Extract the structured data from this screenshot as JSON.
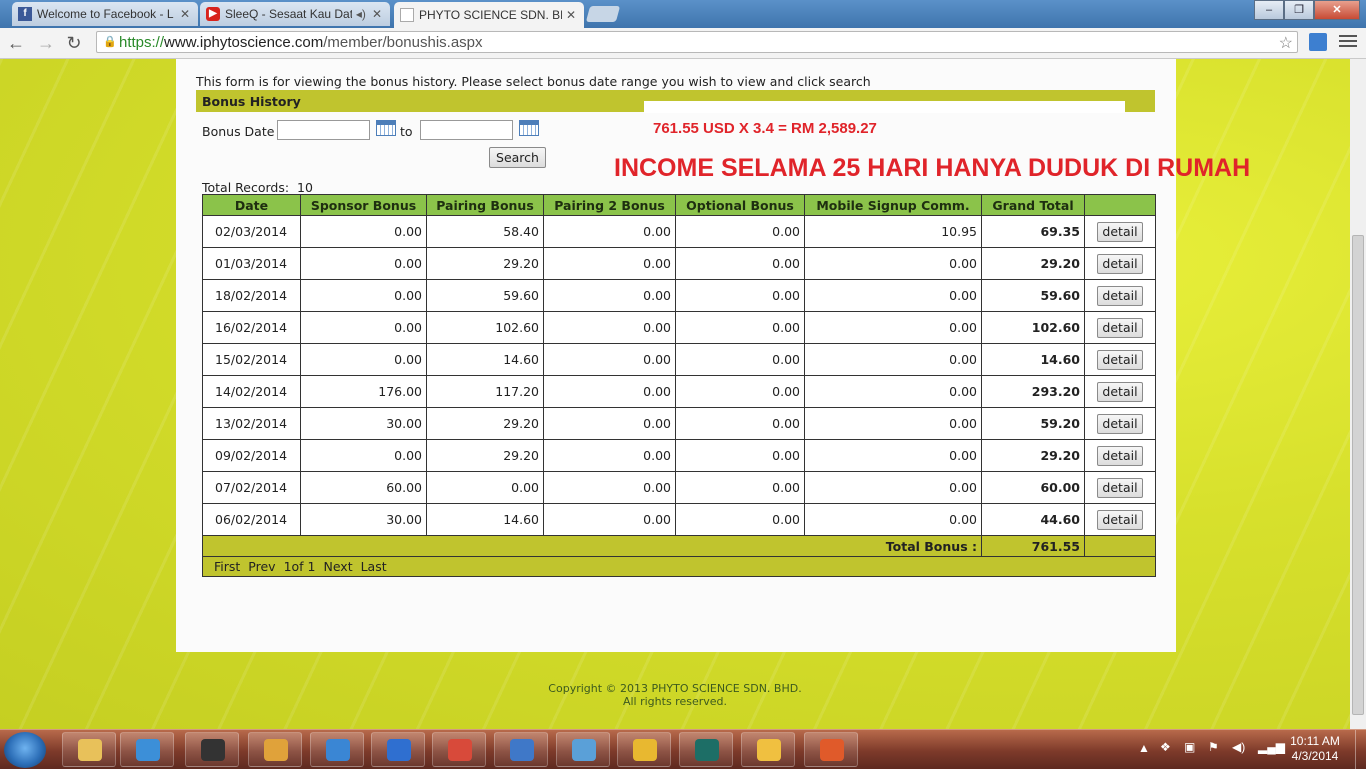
{
  "browser": {
    "tabs": [
      {
        "title": "Welcome to Facebook - L",
        "favicon": "facebook-icon"
      },
      {
        "title": "SleeQ - Sesaat Kau Dat:",
        "favicon": "youtube-icon"
      },
      {
        "title": "PHYTO SCIENCE SDN. BH",
        "favicon": "page-icon",
        "active": true
      }
    ],
    "url_scheme": "https://",
    "url_host": "www.iphytoscience.com",
    "url_path": "/member/bonushis.aspx"
  },
  "page": {
    "intro": "This form is for viewing the bonus history. Please select bonus date range you wish to view and click search",
    "section_title": "Bonus History",
    "bonus_date_label": "Bonus Date",
    "to_label": "to",
    "date_from": "",
    "date_to": "",
    "search_label": "Search",
    "total_records_label": "Total Records:",
    "total_records_value": "10",
    "calc_text": "761.55 USD X 3.4 = RM 2,589.27",
    "income_text": "INCOME SELAMA 25 HARI HANYA DUDUK DI RUMAH"
  },
  "table": {
    "columns": [
      "Date",
      "Sponsor Bonus",
      "Pairing Bonus",
      "Pairing 2 Bonus",
      "Optional Bonus",
      "Mobile Signup Comm.",
      "Grand Total",
      ""
    ],
    "rows": [
      [
        "02/03/2014",
        "0.00",
        "58.40",
        "0.00",
        "0.00",
        "10.95",
        "69.35"
      ],
      [
        "01/03/2014",
        "0.00",
        "29.20",
        "0.00",
        "0.00",
        "0.00",
        "29.20"
      ],
      [
        "18/02/2014",
        "0.00",
        "59.60",
        "0.00",
        "0.00",
        "0.00",
        "59.60"
      ],
      [
        "16/02/2014",
        "0.00",
        "102.60",
        "0.00",
        "0.00",
        "0.00",
        "102.60"
      ],
      [
        "15/02/2014",
        "0.00",
        "14.60",
        "0.00",
        "0.00",
        "0.00",
        "14.60"
      ],
      [
        "14/02/2014",
        "176.00",
        "117.20",
        "0.00",
        "0.00",
        "0.00",
        "293.20"
      ],
      [
        "13/02/2014",
        "30.00",
        "29.20",
        "0.00",
        "0.00",
        "0.00",
        "59.20"
      ],
      [
        "09/02/2014",
        "0.00",
        "29.20",
        "0.00",
        "0.00",
        "0.00",
        "29.20"
      ],
      [
        "07/02/2014",
        "60.00",
        "0.00",
        "0.00",
        "0.00",
        "0.00",
        "60.00"
      ],
      [
        "06/02/2014",
        "30.00",
        "14.60",
        "0.00",
        "0.00",
        "0.00",
        "44.60"
      ]
    ],
    "detail_label": "detail",
    "total_bonus_label": "Total Bonus :",
    "total_bonus_value": "761.55",
    "pager": {
      "first": "First",
      "prev": "Prev",
      "page_info": "1of 1",
      "next": "Next",
      "last": "Last"
    }
  },
  "footer": {
    "copyright": "Copyright © 2013 PHYTO SCIENCE SDN. BHD.",
    "rights": "All rights reserved."
  },
  "taskbar": {
    "apps": [
      "file-explorer-icon",
      "media-player-icon",
      "hp-icon",
      "game-icon",
      "internet-explorer-icon",
      "search-app-icon",
      "chrome-icon",
      "messenger-icon",
      "network-icon",
      "app-icon",
      "r-app-icon",
      "windows-update-icon",
      "window-icon"
    ],
    "time": "10:11 AM",
    "date": "4/3/2014"
  },
  "colors": {
    "accent_green": "#8bc34a",
    "header_olive": "#c0c42e",
    "highlight_red": "#e0242a"
  }
}
